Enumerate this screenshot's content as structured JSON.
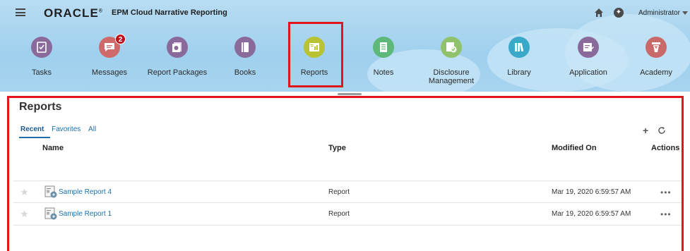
{
  "header": {
    "logo": "ORACLE",
    "logo_mark": "®",
    "app_title": "EPM Cloud Narrative Reporting",
    "user": "Administrator"
  },
  "nav": {
    "items": [
      {
        "label": "Tasks",
        "color": "#8a6a9a",
        "icon": "tasks-icon"
      },
      {
        "label": "Messages",
        "color": "#d06a6a",
        "icon": "messages-icon",
        "badge": "2"
      },
      {
        "label": "Report Packages",
        "color": "#8a6a9a",
        "icon": "report-packages-icon"
      },
      {
        "label": "Books",
        "color": "#8a6a9a",
        "icon": "books-icon"
      },
      {
        "label": "Reports",
        "color": "#b8c232",
        "icon": "reports-icon"
      },
      {
        "label": "Notes",
        "color": "#5db87a",
        "icon": "notes-icon"
      },
      {
        "label": "Disclosure",
        "label2": "Management",
        "color": "#8fc26a",
        "icon": "disclosure-icon"
      },
      {
        "label": "Library",
        "color": "#3aa8c8",
        "icon": "library-icon"
      },
      {
        "label": "Application",
        "color": "#8a6a9a",
        "icon": "application-icon"
      },
      {
        "label": "Academy",
        "color": "#c96a6a",
        "icon": "academy-icon"
      }
    ]
  },
  "panel": {
    "title": "Reports",
    "tabs": [
      "Recent",
      "Favorites",
      "All"
    ],
    "active_tab": "Recent",
    "columns": {
      "name": "Name",
      "type": "Type",
      "modified": "Modified On",
      "actions": "Actions"
    },
    "rows": [
      {
        "name": "Sample Report 4",
        "type": "Report",
        "modified": "Mar 19, 2020 6:59:57 AM",
        "actions": "•••"
      },
      {
        "name": "Sample Report 1",
        "type": "Report",
        "modified": "Mar 19, 2020 6:59:57 AM",
        "actions": "•••"
      }
    ]
  },
  "colors": {
    "accent": "#1d6fa8",
    "highlight": "#e0161c",
    "badge": "#c0101e"
  }
}
